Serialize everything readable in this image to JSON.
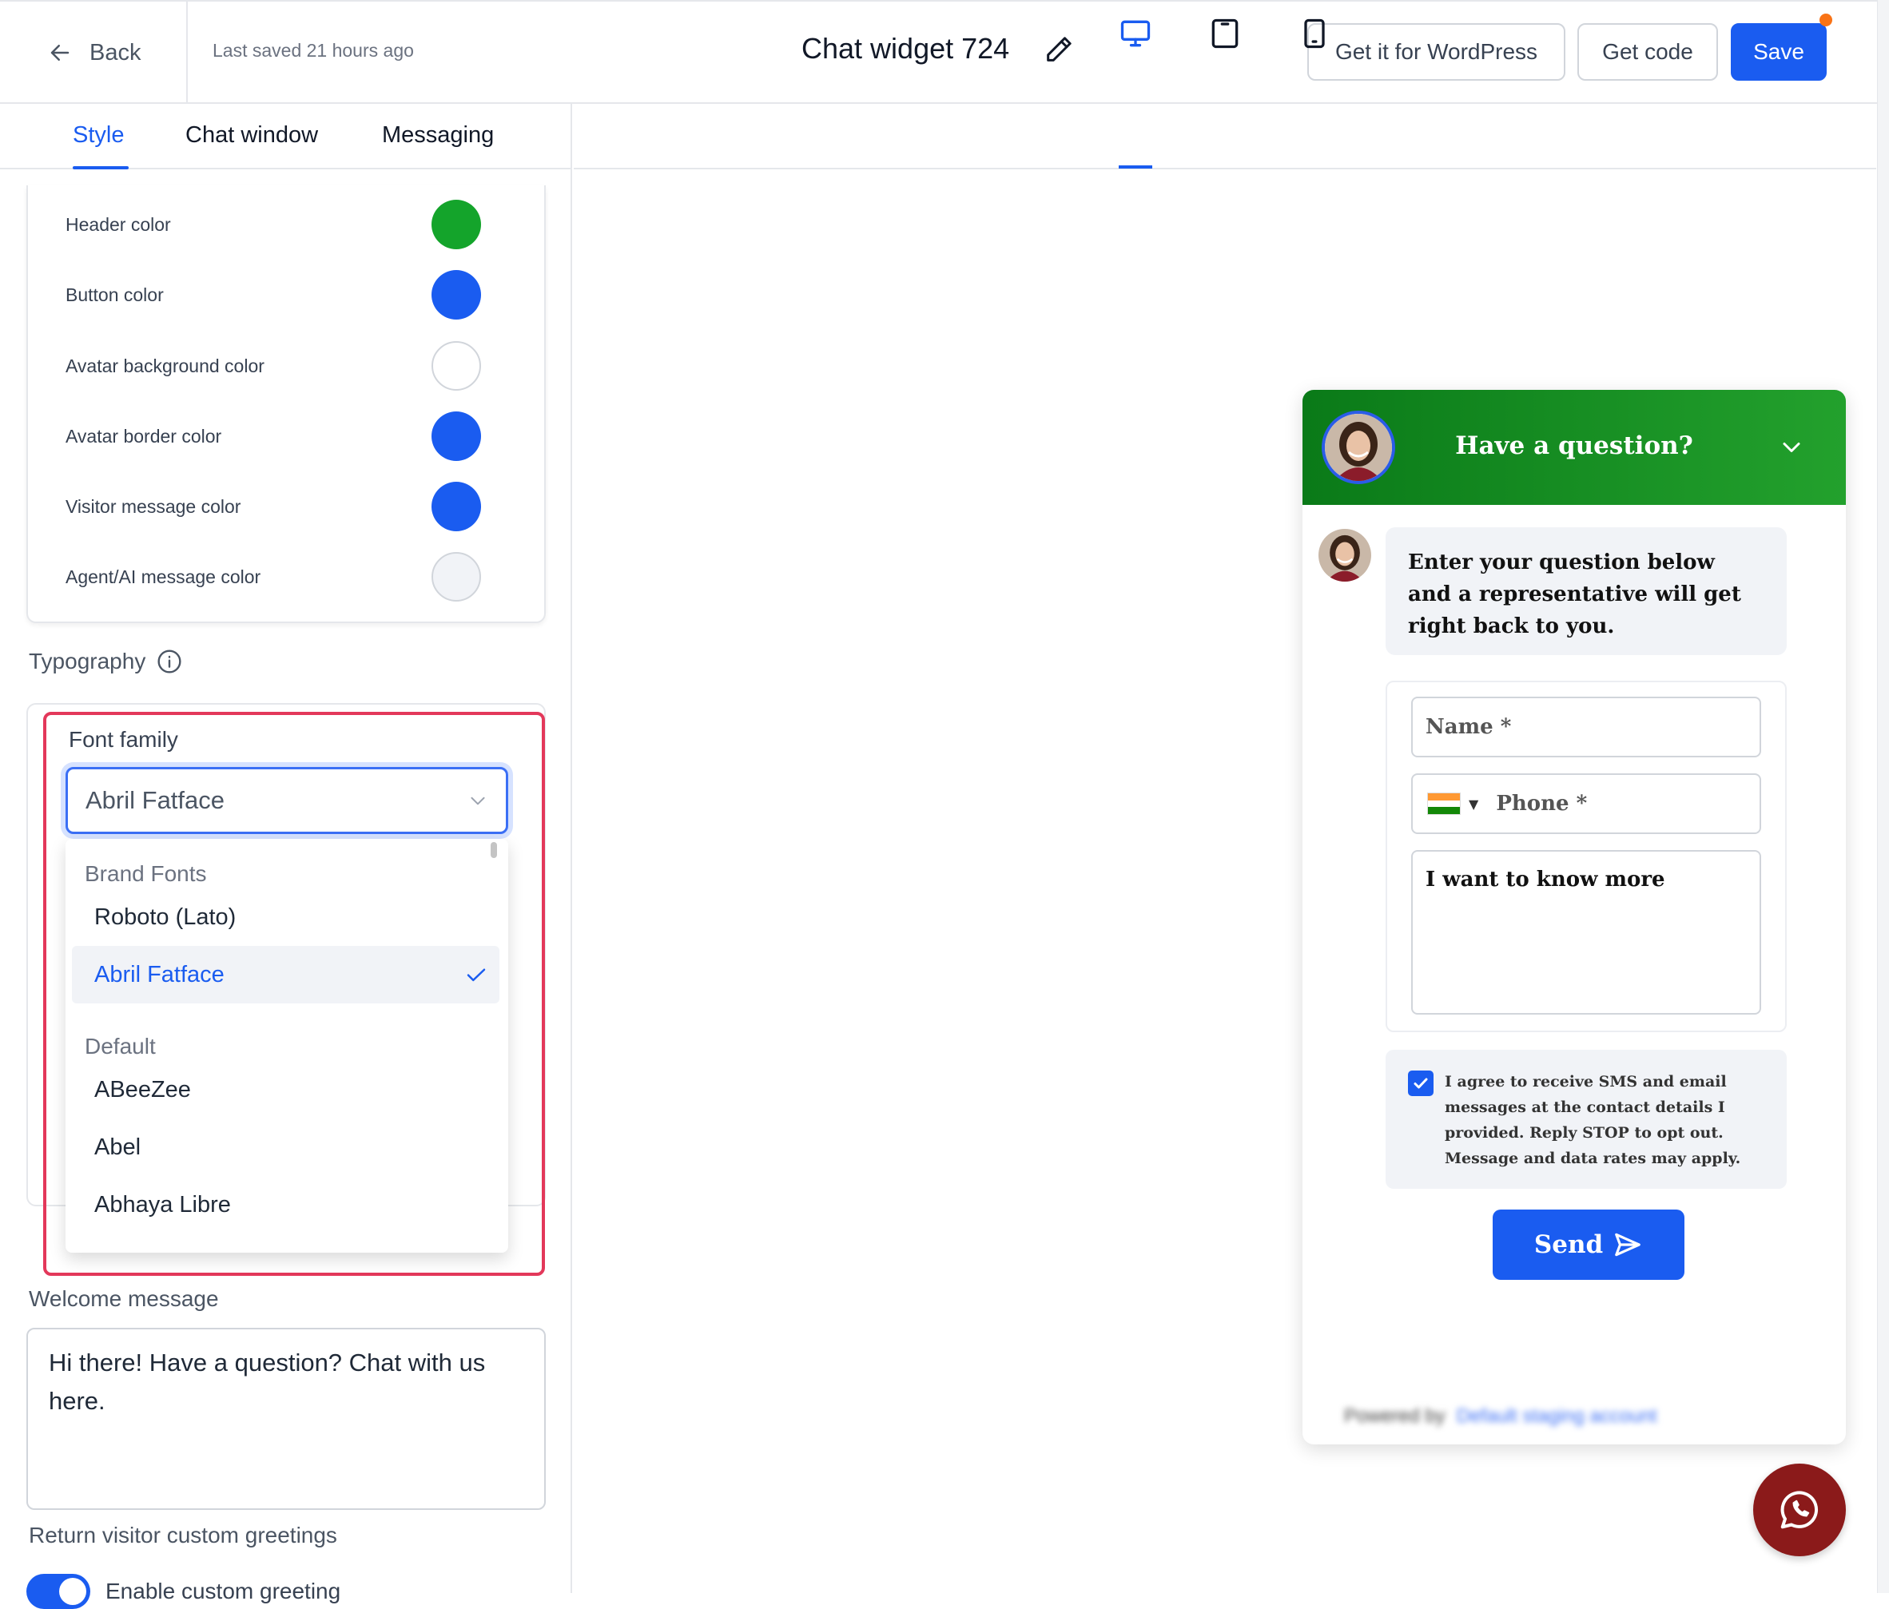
{
  "header": {
    "back_label": "Back",
    "last_saved": "Last saved 21 hours ago",
    "title": "Chat widget 724",
    "wordpress_label": "Get it for WordPress",
    "get_code_label": "Get code",
    "save_label": "Save"
  },
  "tabs": [
    {
      "label": "Style",
      "active": true
    },
    {
      "label": "Chat window",
      "active": false
    },
    {
      "label": "Messaging",
      "active": false
    }
  ],
  "colors": [
    {
      "label": "Header color",
      "value": "#14a42b"
    },
    {
      "label": "Button color",
      "value": "#1a5cf0"
    },
    {
      "label": "Avatar background color",
      "value": "#ffffff"
    },
    {
      "label": "Avatar border color",
      "value": "#1a5cf0"
    },
    {
      "label": "Visitor message color",
      "value": "#1a5cf0"
    },
    {
      "label": "Agent/AI message color",
      "value": "#f1f3f7"
    }
  ],
  "typography": {
    "section_label": "Typography",
    "font_family_label": "Font family",
    "selected_font": "Abril Fatface",
    "dropdown": {
      "groups": [
        {
          "label": "Brand Fonts",
          "items": [
            "Roboto (Lato)",
            "Abril Fatface"
          ]
        },
        {
          "label": "Default",
          "items": [
            "ABeeZee",
            "Abel",
            "Abhaya Libre"
          ]
        }
      ]
    }
  },
  "welcome": {
    "label": "Welcome message",
    "text": "Hi there! Have a question? Chat with us here."
  },
  "return_visitor": {
    "label": "Return visitor custom greetings",
    "toggle_label": "Enable custom greeting",
    "toggle_on": true
  },
  "preview": {
    "active_device": "desktop",
    "header_title": "Have a question?",
    "bot_message": "Enter your question below and a representative will get right back to you.",
    "name_placeholder": "Name *",
    "phone_placeholder": "Phone *",
    "message_value": "I want to know more",
    "consent_text": "I agree to receive SMS and email messages at the contact details I provided. Reply STOP to opt out. Message and data rates may apply.",
    "consent_checked": true,
    "send_label": "Send",
    "powered_by_label": "Powered by",
    "powered_by_link": "Default staging account"
  }
}
